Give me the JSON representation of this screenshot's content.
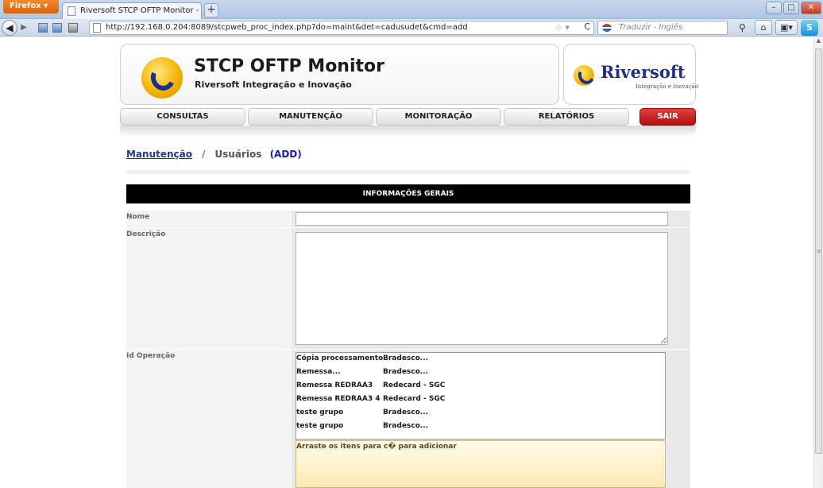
{
  "browser": {
    "menu_button": "Firefox",
    "tab_title": "Riversoft STCP OFTP Monitor - Manuten...",
    "new_tab": "+",
    "url": "http://192.168.0.204:8089/stcpweb_proc_index.php?do=maint&det=cadusudet&cmd=add",
    "translate_placeholder": "Traduzir - Inglês"
  },
  "header": {
    "app_title": "STCP OFTP Monitor",
    "app_subtitle": "Riversoft Integração e Inovação",
    "brand_name": "Riversoft",
    "brand_tagline": "Integração e Inovação"
  },
  "menu": {
    "items": [
      "CONSULTAS",
      "MANUTENÇÃO",
      "MONITORAÇÃO",
      "RELATÓRIOS"
    ],
    "logout": "SAIR"
  },
  "breadcrumb": {
    "link": "Manutenção",
    "separator": "/",
    "current": "Usuários",
    "mode": "(ADD)"
  },
  "form": {
    "section_title": "INFORMAÇÕES GERAIS",
    "fields": {
      "nome": {
        "label": "Nome",
        "value": ""
      },
      "descricao": {
        "label": "Descrição",
        "value": ""
      },
      "id_operacao": {
        "label": "Id Operação"
      }
    },
    "operations": [
      {
        "name": "Cópia processamento",
        "group": "Bradesco..."
      },
      {
        "name": "Remessa...",
        "group": "Bradesco..."
      },
      {
        "name": "Remessa REDRAA3",
        "group": "Redecard - SGC"
      },
      {
        "name": "Remessa REDRAA3 4",
        "group": "Redecard - SGC"
      },
      {
        "name": "teste grupo",
        "group": "Bradesco..."
      },
      {
        "name": "teste grupo",
        "group": "Bradesco..."
      }
    ],
    "drop_hint": "Arraste os itens para c� para adicionar"
  }
}
